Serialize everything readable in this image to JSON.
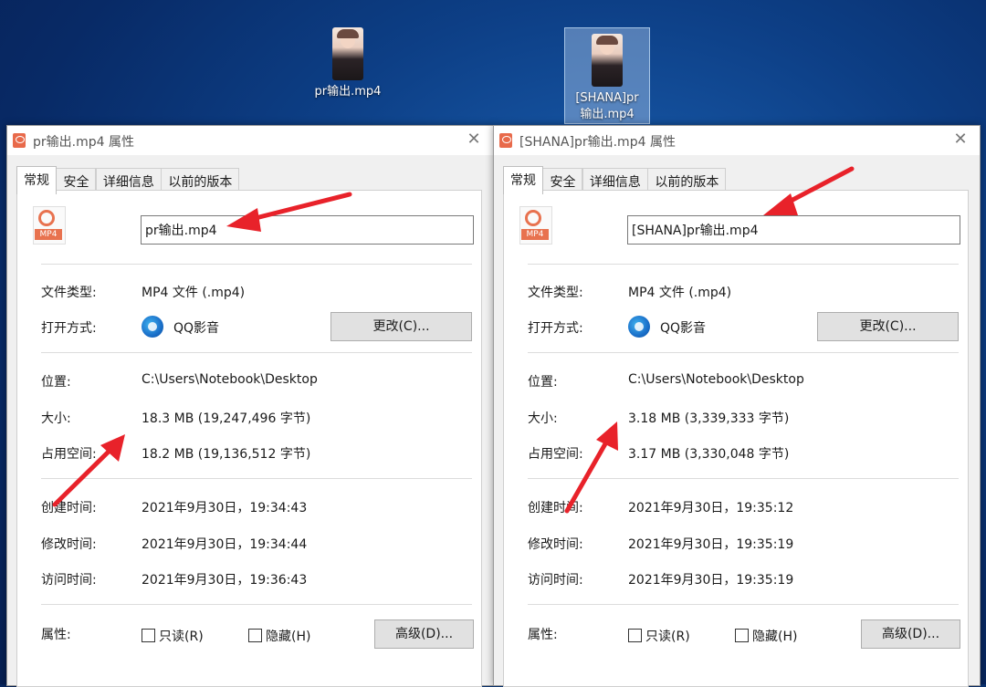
{
  "desktop": {
    "icons": [
      {
        "label": "pr输出.mp4"
      },
      {
        "label_line1": "[SHANA]pr",
        "label_line2": "输出.mp4"
      }
    ]
  },
  "dialogs": [
    {
      "title": "pr输出.mp4 属性",
      "tabs": [
        "常规",
        "安全",
        "详细信息",
        "以前的版本"
      ],
      "icon_badge": "MP4",
      "file_name": "pr输出.mp4",
      "file_type_label": "文件类型:",
      "file_type_value": "MP4 文件 (.mp4)",
      "open_with_label": "打开方式:",
      "open_with_value": "QQ影音",
      "change_button": "更改(C)...",
      "location_label": "位置:",
      "location_value": "C:\\Users\\Notebook\\Desktop",
      "size_label": "大小:",
      "size_value": "18.3 MB (19,247,496 字节)",
      "size_on_disk_label": "占用空间:",
      "size_on_disk_value": "18.2 MB (19,136,512 字节)",
      "created_label": "创建时间:",
      "created_value": "2021年9月30日，19:34:43",
      "modified_label": "修改时间:",
      "modified_value": "2021年9月30日，19:34:44",
      "accessed_label": "访问时间:",
      "accessed_value": "2021年9月30日，19:36:43",
      "attributes_label": "属性:",
      "readonly_label": "只读(R)",
      "hidden_label": "隐藏(H)",
      "advanced_button": "高级(D)...",
      "close_glyph": "✕"
    },
    {
      "title": "[SHANA]pr输出.mp4 属性",
      "tabs": [
        "常规",
        "安全",
        "详细信息",
        "以前的版本"
      ],
      "icon_badge": "MP4",
      "file_name": "[SHANA]pr输出.mp4",
      "file_type_label": "文件类型:",
      "file_type_value": "MP4 文件 (.mp4)",
      "open_with_label": "打开方式:",
      "open_with_value": "QQ影音",
      "change_button": "更改(C)...",
      "location_label": "位置:",
      "location_value": "C:\\Users\\Notebook\\Desktop",
      "size_label": "大小:",
      "size_value": "3.18 MB (3,339,333 字节)",
      "size_on_disk_label": "占用空间:",
      "size_on_disk_value": "3.17 MB (3,330,048 字节)",
      "created_label": "创建时间:",
      "created_value": "2021年9月30日，19:35:12",
      "modified_label": "修改时间:",
      "modified_value": "2021年9月30日，19:35:19",
      "accessed_label": "访问时间:",
      "accessed_value": "2021年9月30日，19:35:19",
      "attributes_label": "属性:",
      "readonly_label": "只读(R)",
      "hidden_label": "隐藏(H)",
      "advanced_button": "高级(D)...",
      "close_glyph": "✕"
    }
  ],
  "colors": {
    "annotation_arrow": "#e8222a",
    "mp4_badge": "#e8724f"
  }
}
